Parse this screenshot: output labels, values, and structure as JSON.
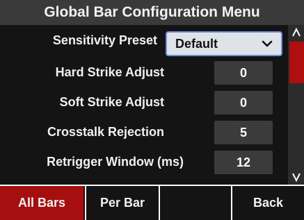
{
  "title": "Global Bar Configuration Menu",
  "settings": {
    "sensitivity_preset": {
      "label": "Sensitivity Preset",
      "value": "Default"
    },
    "rows": [
      {
        "label": "Hard Strike Adjust",
        "value": "0"
      },
      {
        "label": "Soft Strike Adjust",
        "value": "0"
      },
      {
        "label": "Crosstalk Rejection",
        "value": "5"
      },
      {
        "label": "Retrigger Window (ms)",
        "value": "12"
      }
    ]
  },
  "scrollbar": {
    "up_glyph": "^",
    "down_glyph": "V"
  },
  "tabs": {
    "all_bars": "All Bars",
    "per_bar": "Per Bar",
    "empty": "",
    "back": "Back"
  },
  "colors": {
    "accent": "#a50f0f",
    "scroll_thumb": "#b00f0f",
    "title_bg": "#3a3a3a",
    "select_border": "#6b8fd6"
  }
}
